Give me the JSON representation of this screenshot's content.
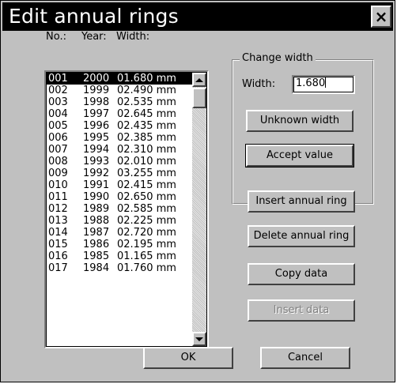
{
  "window": {
    "title": "Edit annual rings",
    "close_glyph": "×"
  },
  "list": {
    "headers": {
      "no": "No.:",
      "year": "Year:",
      "width": "Width:"
    },
    "rows": [
      [
        "001",
        "2000",
        "01.680 mm"
      ],
      [
        "002",
        "1999",
        "02.490 mm"
      ],
      [
        "003",
        "1998",
        "02.535 mm"
      ],
      [
        "004",
        "1997",
        "02.645 mm"
      ],
      [
        "005",
        "1996",
        "02.435 mm"
      ],
      [
        "006",
        "1995",
        "02.385 mm"
      ],
      [
        "007",
        "1994",
        "02.310 mm"
      ],
      [
        "008",
        "1993",
        "02.010 mm"
      ],
      [
        "009",
        "1992",
        "03.255 mm"
      ],
      [
        "010",
        "1991",
        "02.415 mm"
      ],
      [
        "011",
        "1990",
        "02.650 mm"
      ],
      [
        "012",
        "1989",
        "02.585 mm"
      ],
      [
        "013",
        "1988",
        "02.225 mm"
      ],
      [
        "014",
        "1987",
        "02.720 mm"
      ],
      [
        "015",
        "1986",
        "02.195 mm"
      ],
      [
        "016",
        "1985",
        "01.165 mm"
      ],
      [
        "017",
        "1984",
        "01.760 mm"
      ]
    ],
    "selected_index": 0
  },
  "change_width": {
    "group_label": "Change width",
    "width_label": "Width:",
    "width_value": "1.680",
    "unknown_label": "Unknown width",
    "accept_label": "Accept value"
  },
  "actions": {
    "insert_ring": "Insert annual ring",
    "delete_ring": "Delete annual ring",
    "copy_data": "Copy data",
    "insert_data": "Insert data"
  },
  "footer": {
    "ok": "OK",
    "cancel": "Cancel"
  }
}
